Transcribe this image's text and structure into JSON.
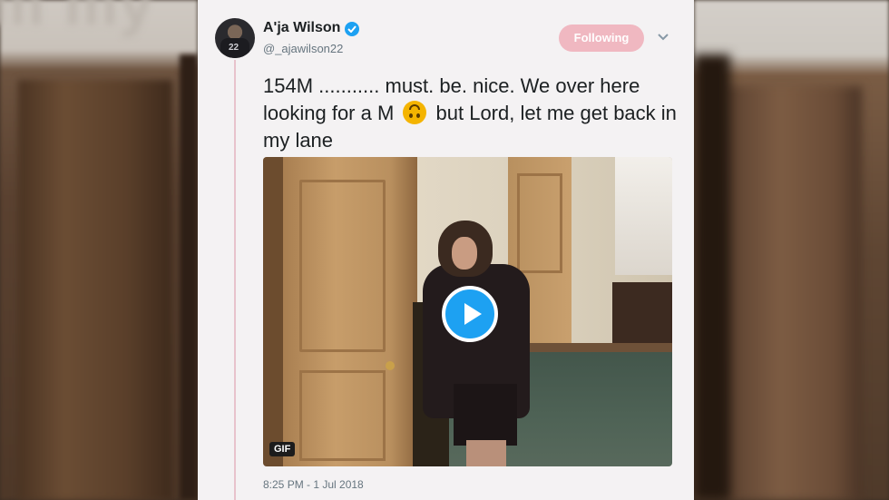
{
  "author": {
    "name": "A'ja Wilson",
    "handle": "@_ajawilson22",
    "avatar_number": "22",
    "verified": true
  },
  "header": {
    "follow_label": "Following",
    "follow_color": "#f0b8c1"
  },
  "tweet": {
    "text_part1": "154M ........... must. be. nice. We over here looking for a M",
    "emoji": "upside-down-face-emoji",
    "text_part2": "but Lord, let me get back in my lane",
    "timestamp": "8:25 PM - 1 Jul 2018"
  },
  "media": {
    "type_badge": "GIF",
    "play_icon": "play-icon",
    "accent": "#1da1f2"
  },
  "background": {
    "blurred_text": "m my"
  }
}
